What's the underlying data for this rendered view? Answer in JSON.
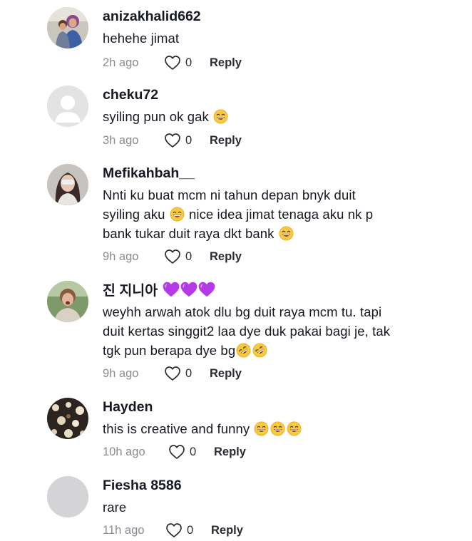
{
  "comments": [
    {
      "username": "anizakhalid662",
      "avatar": "photo-avatar-mother-child",
      "text": [
        "hehehe jimat"
      ],
      "time": "2h ago",
      "likes": "0",
      "reply": "Reply"
    },
    {
      "username": "cheku72",
      "avatar": "default-avatar-gray",
      "text": [
        "syiling pun ok gak"
      ],
      "emoji": "grinning-sweat-emoji",
      "time": "3h ago",
      "likes": "0",
      "reply": "Reply"
    },
    {
      "username": "Mefikahbah__",
      "avatar": "photo-avatar-woman",
      "text": [
        "Nnti ku buat mcm ni tahun depan bnyk duit",
        "syiling aku",
        "nice idea jimat tenaga aku nk p",
        "bank tukar duit raya dkt bank"
      ],
      "time": "9h ago",
      "likes": "0",
      "reply": "Reply"
    },
    {
      "username": "진 지니아",
      "avatar": "photo-avatar-boy-outdoors",
      "text": [
        "weyhh arwah atok dlu bg duit raya mcm tu. tapi",
        "duit kertas singgit2 laa dye duk pakai bagi je, tak",
        "tgk pun berapa dye bg"
      ],
      "emoji": "rolling-laughing-emoji",
      "time": "9h ago",
      "likes": "0",
      "reply": "Reply"
    },
    {
      "username": "Hayden",
      "avatar": "photo-avatar-dark-pattern",
      "text": [
        "this is creative and funny"
      ],
      "time": "10h ago",
      "likes": "0",
      "reply": "Reply"
    },
    {
      "username": "Fiesha 8586",
      "avatar": "default-avatar-gray-plain",
      "text": [
        "rare"
      ],
      "time": "11h ago",
      "likes": "0",
      "reply": "Reply"
    }
  ]
}
